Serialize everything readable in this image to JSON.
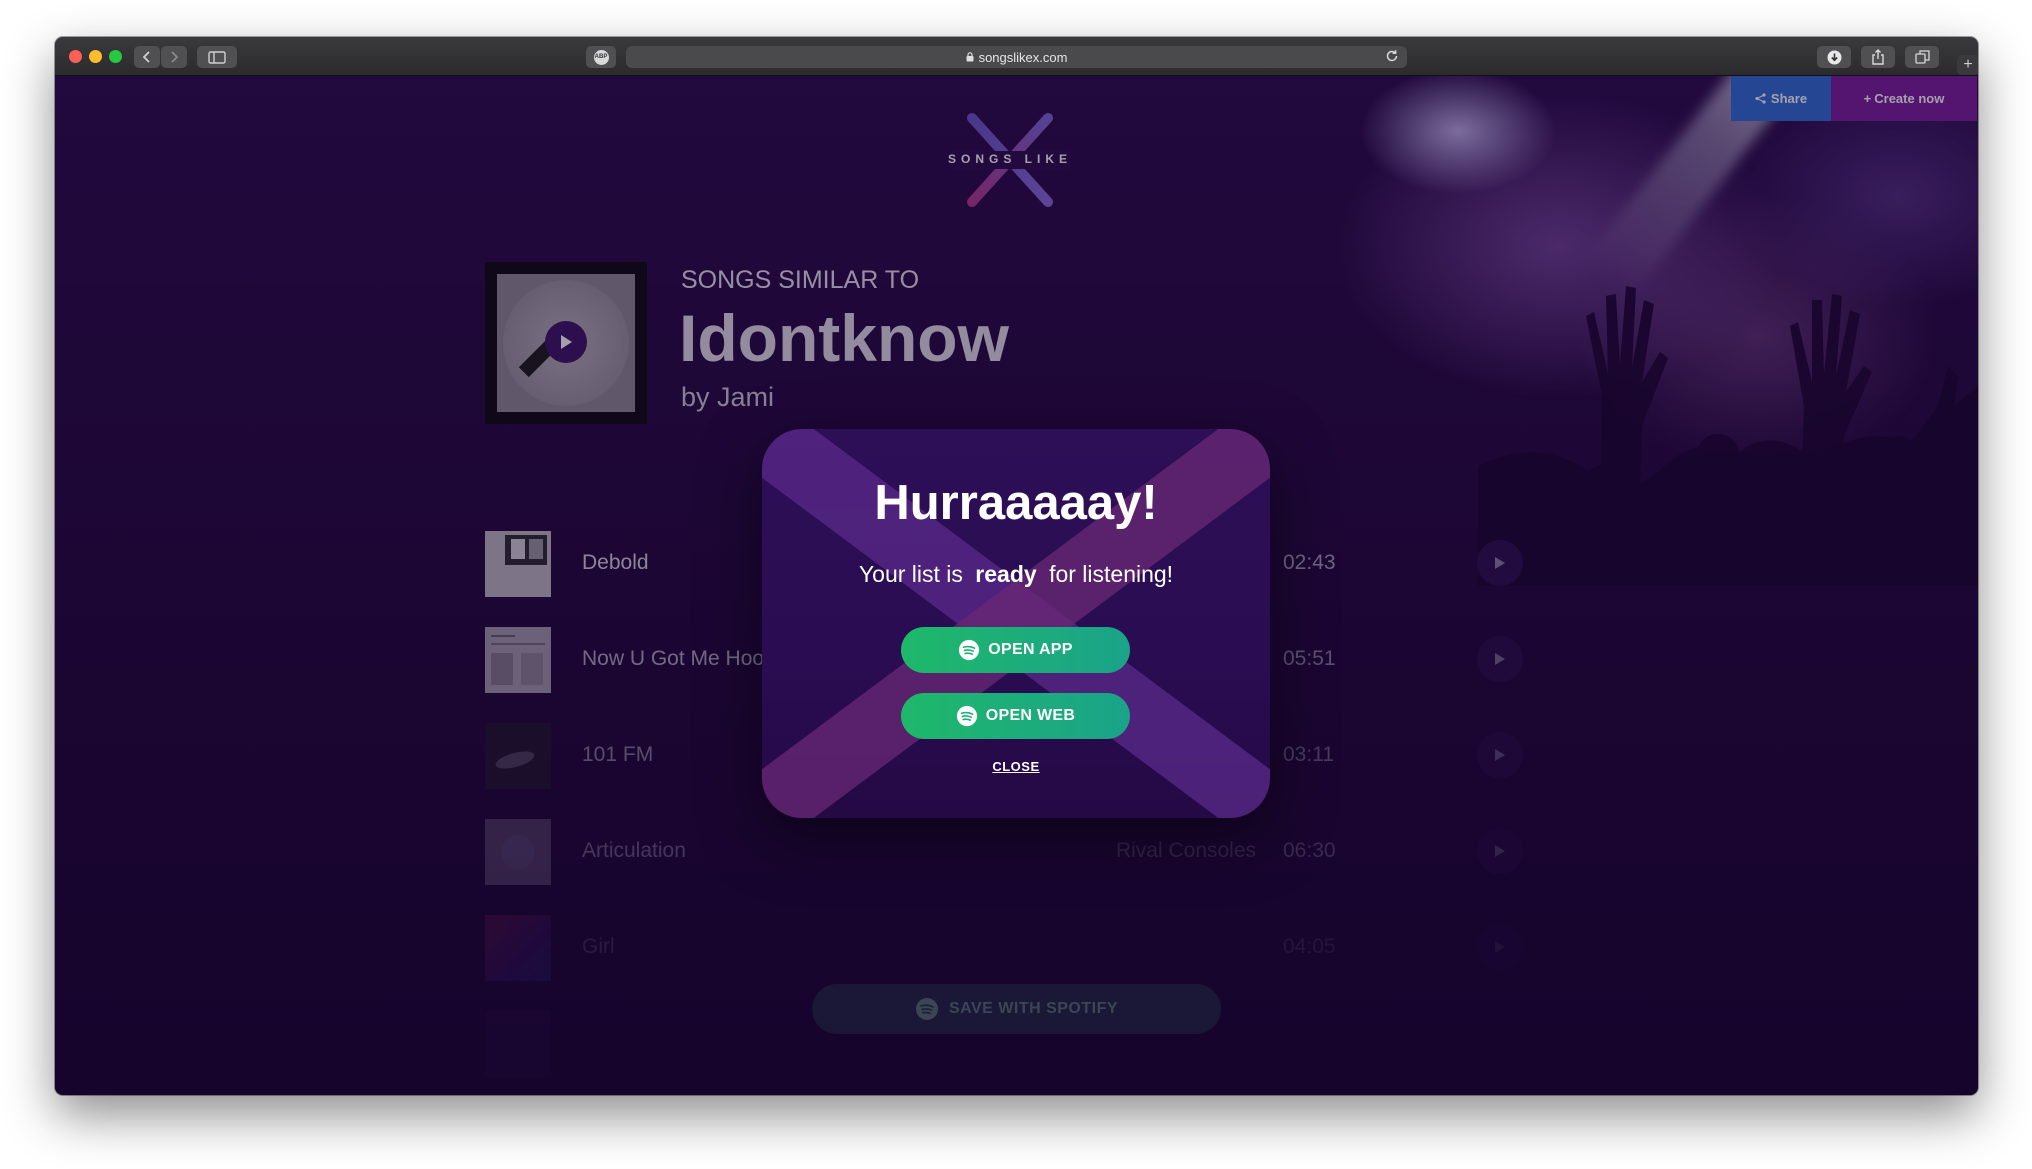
{
  "browser": {
    "url": "songslikex.com"
  },
  "nav": {
    "share_label": "Share",
    "create_label": "Create now"
  },
  "logo": {
    "text": "SONGS LIKE"
  },
  "header": {
    "similar_label": "SONGS SIMILAR TO",
    "song_title": "Idontknow",
    "song_by": "by Jami"
  },
  "tracks": [
    {
      "name": "Debold",
      "artist": "",
      "duration": "02:43"
    },
    {
      "name": "Now U Got Me Hoo",
      "artist": "",
      "duration": "05:51"
    },
    {
      "name": "101 FM",
      "artist": "",
      "duration": "03:11"
    },
    {
      "name": "Articulation",
      "artist": "Rival Consoles",
      "duration": "06:30"
    },
    {
      "name": "Girl",
      "artist": "",
      "duration": "04:05"
    }
  ],
  "save_button": {
    "label": "SAVE WITH SPOTIFY"
  },
  "modal": {
    "title": "Hurraaaaay!",
    "message_before": "Your list is",
    "message_bold": "ready",
    "message_after": "for listening!",
    "open_app_label": "OPEN APP",
    "open_web_label": "OPEN WEB",
    "close_label": "CLOSE"
  },
  "colors": {
    "spotify_green": "#1fb86a",
    "share_blue": "#2f6fd6",
    "create_purple": "#7a1f9d",
    "background": "#23093f"
  }
}
